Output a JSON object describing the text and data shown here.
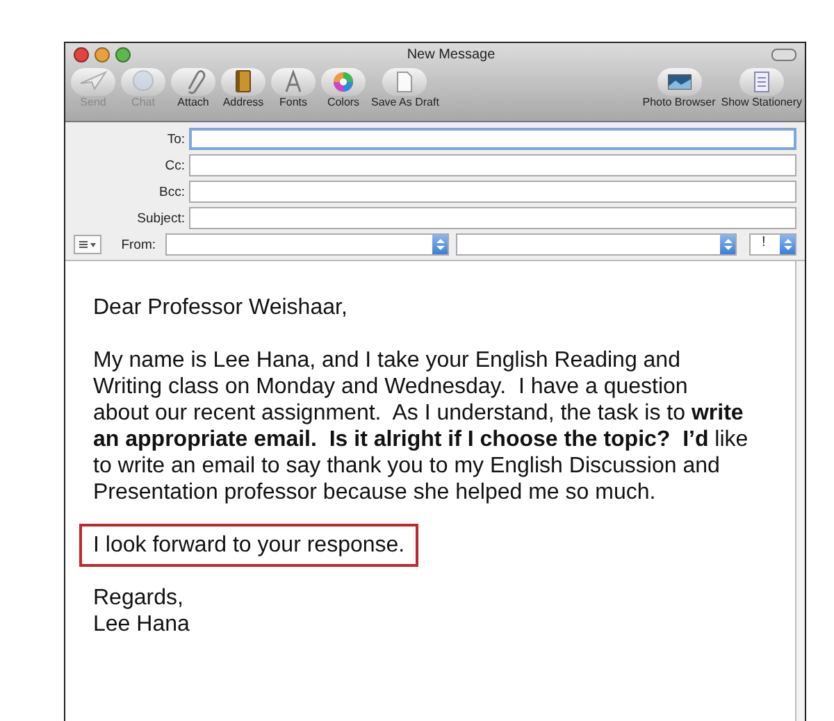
{
  "window": {
    "title": "New Message"
  },
  "toolbar": [
    {
      "label": "Send",
      "disabled": true
    },
    {
      "label": "Chat",
      "disabled": true
    },
    {
      "label": "Attach",
      "disabled": false
    },
    {
      "label": "Address",
      "disabled": false
    },
    {
      "label": "Fonts",
      "disabled": false
    },
    {
      "label": "Colors",
      "disabled": false
    },
    {
      "label": "Save As Draft",
      "disabled": false
    },
    {
      "label": "Photo Browser",
      "disabled": false
    },
    {
      "label": "Show Stationery",
      "disabled": false
    }
  ],
  "fields": [
    {
      "label": "To:",
      "focused": true
    },
    {
      "label": "Cc:",
      "focused": false
    },
    {
      "label": "Bcc:",
      "focused": false
    },
    {
      "label": "Subject:",
      "focused": false
    }
  ],
  "from": {
    "label": "From:",
    "priority": "!"
  },
  "body": [
    {
      "text": "Dear Professor Weishaar,",
      "highlighted": false
    },
    {
      "text": "My name is Lee Hana, and I take your English Reading and Writing class on Monday and Wednesday.  I have a question about our recent assignment.  As I understand, the task is to **write an appropriate email.  Is it alright if I choose the topic?  I’d** like to write an email to say thank you to my English Discussion and Presentation professor because she helped me so much.",
      "highlighted": false
    },
    {
      "text": "I look forward to your response.",
      "highlighted": true
    },
    {
      "text": "Regards,\nLee Hana",
      "highlighted": false
    }
  ]
}
